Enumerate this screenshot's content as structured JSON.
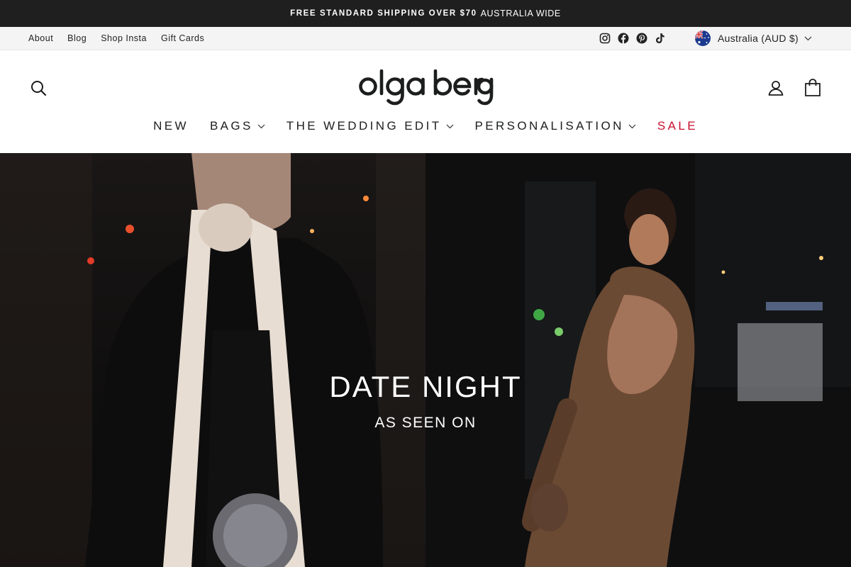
{
  "announcement": {
    "bold": "FREE STANDARD SHIPPING OVER $70",
    "normal": "AUSTRALIA WIDE"
  },
  "utility_links": [
    "About",
    "Blog",
    "Shop Insta",
    "Gift Cards"
  ],
  "socials": [
    "instagram-icon",
    "facebook-icon",
    "pinterest-icon",
    "tiktok-icon"
  ],
  "country": {
    "label": "Australia (AUD $)",
    "flag": "australia-flag"
  },
  "brand": {
    "name": "olga berg"
  },
  "nav": [
    {
      "label": "NEW",
      "dropdown": false
    },
    {
      "label": "BAGS",
      "dropdown": true
    },
    {
      "label": "THE WEDDING EDIT",
      "dropdown": true
    },
    {
      "label": "PERSONALISATION",
      "dropdown": true
    },
    {
      "label": "SALE",
      "dropdown": false
    }
  ],
  "hero": {
    "title": "DATE NIGHT",
    "subtitle": "AS SEEN ON"
  },
  "colors": {
    "announcement_bg": "#1f1f1f",
    "sale": "#c8102e",
    "text": "#1c1d1d"
  }
}
